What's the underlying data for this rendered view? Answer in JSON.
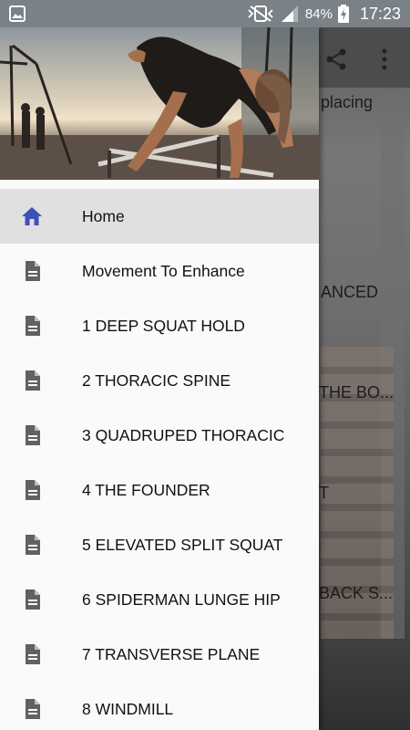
{
  "status_bar": {
    "battery_percent": "84%",
    "time": "17:23"
  },
  "background": {
    "text_1": "placing",
    "text_2": "ANCED",
    "text_3": "THE BO...",
    "text_4": "T",
    "text_5": "BACK S..."
  },
  "drawer": {
    "header_image": "athlete doing exercise on parallel bars at beach gym",
    "items": [
      {
        "label": "Home",
        "icon": "home-icon",
        "active": true
      },
      {
        "label": "Movement To Enhance",
        "icon": "document-icon"
      },
      {
        "label": "1 DEEP SQUAT HOLD",
        "icon": "document-icon"
      },
      {
        "label": "2 THORACIC SPINE",
        "icon": "document-icon"
      },
      {
        "label": "3 QUADRUPED THORACIC",
        "icon": "document-icon"
      },
      {
        "label": "4 THE FOUNDER",
        "icon": "document-icon"
      },
      {
        "label": "5 ELEVATED SPLIT SQUAT",
        "icon": "document-icon"
      },
      {
        "label": "6 SPIDERMAN LUNGE HIP",
        "icon": "document-icon"
      },
      {
        "label": "7 TRANSVERSE PLANE",
        "icon": "document-icon"
      },
      {
        "label": "8 WINDMILL",
        "icon": "document-icon"
      }
    ]
  },
  "colors": {
    "status_bar": "#7a8288",
    "home_icon": "#3f51b5",
    "doc_icon": "#616161",
    "active_row": "#e0e0e0"
  }
}
